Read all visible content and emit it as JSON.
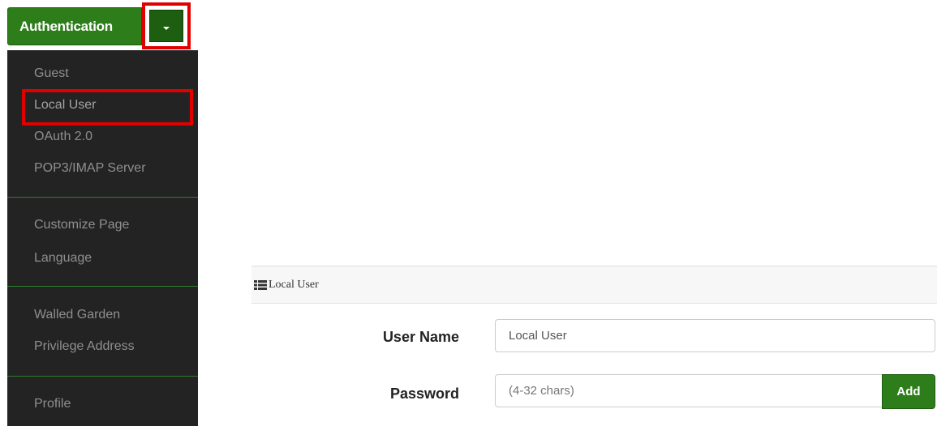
{
  "auth_button": {
    "label": "Authentication"
  },
  "menu": {
    "groups": [
      [
        "Guest",
        "Local User",
        "OAuth 2.0",
        "POP3/IMAP Server"
      ],
      [
        "Customize Page",
        "Language"
      ],
      [
        "Walled Garden",
        "Privilege Address"
      ],
      [
        "Profile"
      ]
    ],
    "highlighted": "Local User"
  },
  "panel": {
    "title": "Local User",
    "icon": "list-icon",
    "username": {
      "label": "User Name",
      "value": "Local User"
    },
    "password": {
      "label": "Password",
      "value": "",
      "placeholder": "(4-32 chars)"
    },
    "add_label": "Add"
  },
  "colors": {
    "accent_green": "#2e7d1b",
    "menu_bg": "#232323",
    "highlight_red": "#e00000"
  }
}
